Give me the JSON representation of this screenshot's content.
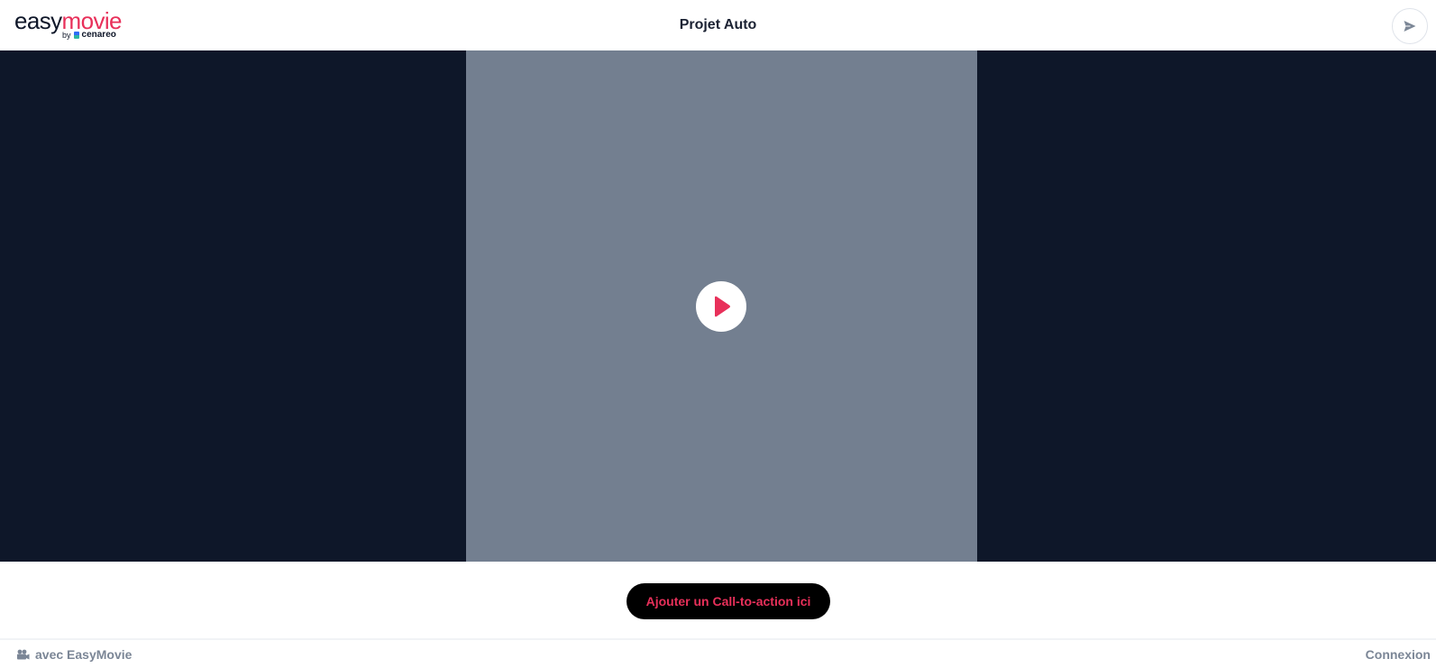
{
  "header": {
    "logo": {
      "word_easy": "easy",
      "word_movie": "movie",
      "by": "by",
      "brand": "cenareo"
    },
    "title": "Projet Auto",
    "share_icon": "send-icon"
  },
  "player": {
    "play_icon": "play-icon",
    "accent_color": "#e8305a"
  },
  "cta": {
    "label": "Ajouter un Call-to-action ici"
  },
  "footer": {
    "left_icon": "camera-icon",
    "left_label": "avec EasyMovie",
    "right_label": "Connexion"
  },
  "colors": {
    "stage_background": "#0e1729",
    "video_placeholder": "#737f90",
    "brand_pink": "#e8305a",
    "muted_text": "#7b8696"
  }
}
